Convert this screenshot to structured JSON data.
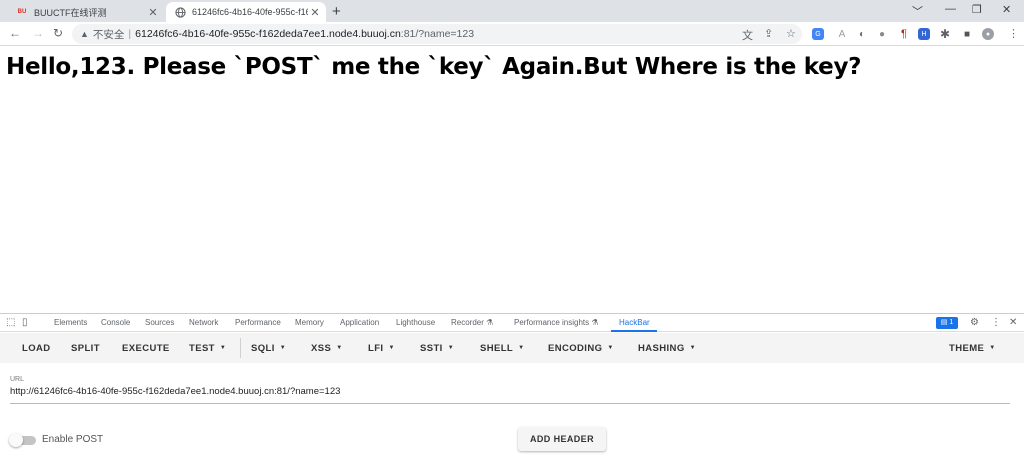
{
  "browser": {
    "tabs": [
      {
        "title": "BUUCTF在线评测",
        "favicon": "BU"
      },
      {
        "title": "61246fc6-4b16-40fe-955c-f16"
      }
    ],
    "new_tab": "+",
    "window_controls": {
      "minimize": "﹀",
      "restore": "—",
      "maximize": "❐",
      "close": "✕"
    },
    "nav": {
      "back": "←",
      "forward": "→",
      "reload": "↻"
    },
    "address": {
      "security_label": "不安全",
      "separator": "|",
      "host": "61246fc6-4b16-40fe-955c-f162deda7ee1.node4.buuoj.cn",
      "rest": ":81/?name=123"
    },
    "extensions": [
      {
        "name": "google-translate-icon",
        "glyph": "G",
        "color": "#4285f4"
      },
      {
        "name": "extension-a-icon",
        "glyph": "A",
        "color": "#9aa0a6"
      },
      {
        "name": "extension-b-icon",
        "glyph": "◐",
        "color": "#6e6e6e"
      },
      {
        "name": "extension-c-icon",
        "glyph": "●",
        "color": "#8a8a8a"
      },
      {
        "name": "extension-d-icon",
        "glyph": "¶",
        "color": "#c5221f"
      },
      {
        "name": "extension-e-icon",
        "glyph": "H",
        "color": "#3367d6"
      },
      {
        "name": "extension-f-icon",
        "glyph": "■",
        "color": "#555555"
      }
    ]
  },
  "page": {
    "heading": "Hello,123. Please `POST` me the `key` Again.But Where is the key?"
  },
  "devtools": {
    "tabs": [
      "Elements",
      "Console",
      "Sources",
      "Network",
      "Performance",
      "Memory",
      "Application",
      "Lighthouse",
      "Recorder ⚗",
      "Performance insights ⚗",
      "HackBar"
    ],
    "active_tab": "HackBar",
    "message_count": "1"
  },
  "hackbar": {
    "buttons": [
      "LOAD",
      "SPLIT",
      "EXECUTE",
      "TEST",
      "SQLI",
      "XSS",
      "LFI",
      "SSTI",
      "SHELL",
      "ENCODING",
      "HASHING",
      "THEME"
    ],
    "url_label": "URL",
    "url_value": "http://61246fc6-4b16-40fe-955c-f162deda7ee1.node4.buuoj.cn:81/?name=123",
    "enable_post_label": "Enable POST",
    "enable_post": false,
    "add_header_label": "ADD HEADER"
  },
  "colors": {
    "accent": "#1a73e8",
    "tabstrip": "#dee1e6",
    "hackbar_bar": "#f4f4f4"
  }
}
